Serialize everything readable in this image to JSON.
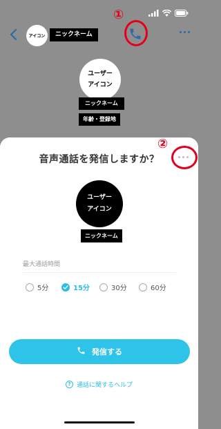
{
  "status_bar": {
    "time": "",
    "icons": [
      "signal-icon",
      "wifi-icon",
      "battery-icon"
    ]
  },
  "header": {
    "avatar_label": "アイコン",
    "nickname": "ニックネーム",
    "marker_1": "①"
  },
  "profile": {
    "avatar_line1": "ユーザー",
    "avatar_line2": "アイコン",
    "nickname": "ニックネーム",
    "age_location": "年齢・登録地"
  },
  "dialog": {
    "title": "音声通話を発信しますか？",
    "marker_2": "②",
    "avatar_line1": "ユーザー",
    "avatar_line2": "アイコン",
    "nickname": "ニックネーム",
    "max_duration_label": "最大通話時間",
    "options": [
      {
        "label": "5分",
        "selected": false
      },
      {
        "label": "15分",
        "selected": true
      },
      {
        "label": "30分",
        "selected": false
      },
      {
        "label": "60分",
        "selected": false
      }
    ],
    "call_button_label": "発信する",
    "help_link": "通話に関するヘルプ"
  },
  "colors": {
    "accent": "#2ec3e8",
    "marker": "#e4001a",
    "nav_icon": "#2d6aa6"
  }
}
